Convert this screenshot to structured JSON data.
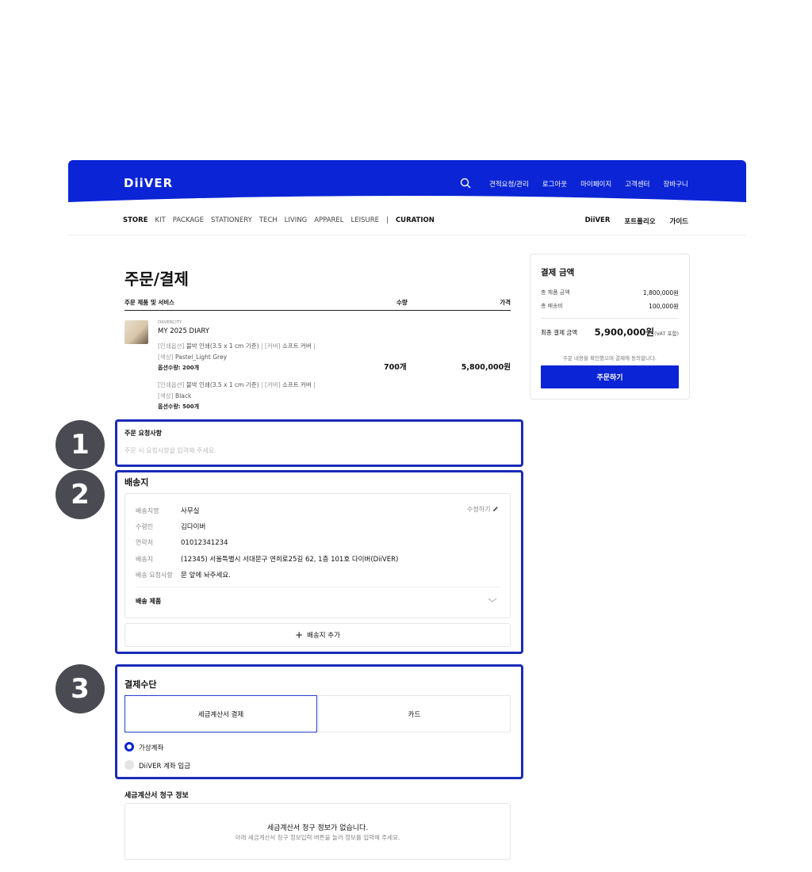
{
  "header": {
    "logo": "DiiVER",
    "nav": [
      "견적요청/관리",
      "로그아웃",
      "마이페이지",
      "고객센터",
      "장바구니"
    ]
  },
  "categories": {
    "store": "STORE",
    "items": [
      "KIT",
      "PACKAGE",
      "STATIONERY",
      "TECH",
      "LIVING",
      "APPAREL",
      "LEISURE"
    ],
    "separator": "|",
    "curation": "CURATION",
    "right": [
      "DiiVER",
      "포트폴리오",
      "가이드"
    ]
  },
  "page": {
    "title": "주문/결제"
  },
  "table": {
    "col_product": "주문 제품 및 서비스",
    "col_qty": "수량",
    "col_price": "가격"
  },
  "product": {
    "brand": "DIIVERCITY",
    "name": "MY 2025 DIARY",
    "options": [
      {
        "print_key": "[인쇄옵션]",
        "print": "불박 인쇄(3.5 x 1 cm 기준)",
        "cover_key": "[커버]",
        "cover": "소프트 커버",
        "color_key": "[색상]",
        "color": "Pastel_Light Grey",
        "qty_label": "옵션수량: 200개"
      },
      {
        "print_key": "[인쇄옵션]",
        "print": "불박 인쇄(3.5 x 1 cm 기준)",
        "cover_key": "[커버]",
        "cover": "소프트 커버",
        "color_key": "[색상]",
        "color": "Black",
        "qty_label": "옵션수량: 500개"
      }
    ],
    "qty": "700개",
    "price": "5,800,000원"
  },
  "request": {
    "label": "주문 요청사항",
    "placeholder": "주문 시 요청사항을 입력해 주세요."
  },
  "badges": [
    "1",
    "2",
    "3"
  ],
  "shipping": {
    "title": "배송지",
    "edit": "수정하기",
    "rows": [
      {
        "key": "배송지명",
        "value": "사무실"
      },
      {
        "key": "수령인",
        "value": "김다이버"
      },
      {
        "key": "연락처",
        "value": "01012341234"
      },
      {
        "key": "배송지",
        "value": "(12345) 서울특별시 서대문구 연희로25길 62, 1층 101호 다이버(DiiVER)"
      },
      {
        "key": "배송 요청사항",
        "value": "문 앞에 놔주세요."
      }
    ],
    "products_label": "배송 제품",
    "add_label": "배송지 추가"
  },
  "payment": {
    "title": "결제수단",
    "tabs": [
      "세금계산서 결제",
      "카드"
    ],
    "options": [
      "가상계좌",
      "DiiVER 계좌 입금"
    ]
  },
  "tax": {
    "title": "세금계산서 청구 정보",
    "empty_title": "세금계산서 청구 정보가 없습니다.",
    "empty_desc": "아래 세금계산서 청구 정보입력 버튼을 눌러 정보를 입력해 주세요."
  },
  "summary": {
    "title": "결제 금액",
    "product_total_label": "총 제품 금액",
    "product_total": "1,800,000원",
    "shipping_label": "총 배송비",
    "shipping": "100,000원",
    "final_label": "최종 결제 금액",
    "final": "5,900,000원",
    "vat": "(VAT 포함)",
    "agree": "주문 내용을 확인했으며 결제에 동의합니다.",
    "order_button": "주문하기"
  },
  "colors": {
    "brand": "#0a24d6",
    "highlight_border": "#1a2bb8",
    "badge": "#4a4b52"
  }
}
